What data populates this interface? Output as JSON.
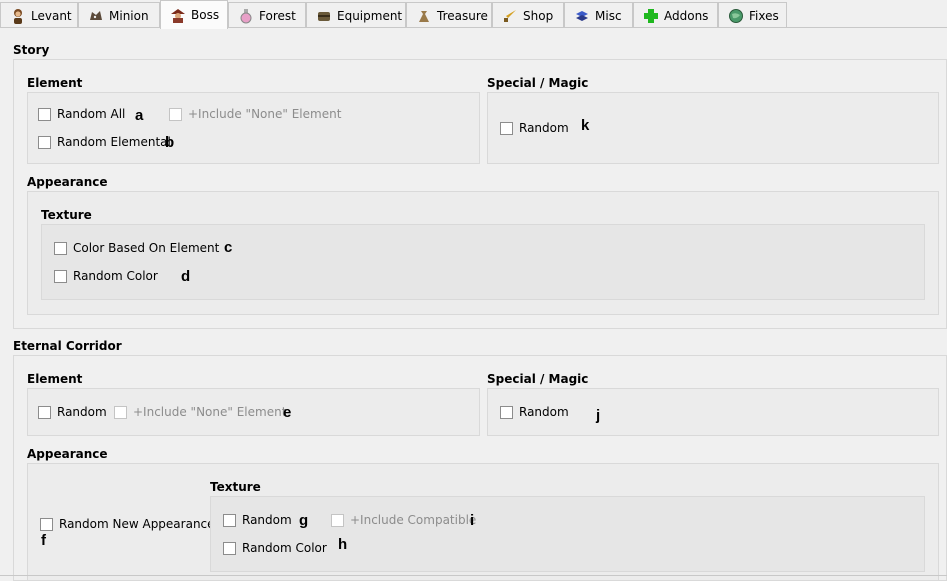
{
  "tabs": [
    {
      "label": "Levant",
      "icon": "character-icon",
      "active": false
    },
    {
      "label": "Minion",
      "icon": "beast-icon",
      "active": false
    },
    {
      "label": "Boss",
      "icon": "boss-icon",
      "active": true
    },
    {
      "label": "Forest",
      "icon": "potion-icon",
      "active": false
    },
    {
      "label": "Equipment",
      "icon": "chest-icon",
      "active": false
    },
    {
      "label": "Treasure",
      "icon": "bag-icon",
      "active": false
    },
    {
      "label": "Shop",
      "icon": "sword-icon",
      "active": false
    },
    {
      "label": "Misc",
      "icon": "misc-icon",
      "active": false
    },
    {
      "label": "Addons",
      "icon": "plus-icon",
      "active": false
    },
    {
      "label": "Fixes",
      "icon": "globe-icon",
      "active": false
    }
  ],
  "story": {
    "title": "Story",
    "element": {
      "title": "Element",
      "random_all": "Random All",
      "include_none": "+Include \"None\" Element",
      "random_elemental": "Random Elemental"
    },
    "special": {
      "title": "Special / Magic",
      "random": "Random"
    },
    "appearance": {
      "title": "Appearance",
      "texture": {
        "title": "Texture",
        "color_based": "Color Based On Element",
        "random_color": "Random Color"
      }
    }
  },
  "corridor": {
    "title": "Eternal Corridor",
    "element": {
      "title": "Element",
      "random": "Random",
      "include_none": "+Include \"None\" Element"
    },
    "special": {
      "title": "Special / Magic",
      "random": "Random"
    },
    "appearance": {
      "title": "Appearance",
      "random_new": "Random New Appearance",
      "texture": {
        "title": "Texture",
        "random": "Random",
        "include_compatible": "+Include Compatible",
        "random_color": "Random Color"
      }
    }
  },
  "annotations": {
    "a": "a",
    "b": "b",
    "c": "c",
    "d": "d",
    "e": "e",
    "f": "f",
    "g": "g",
    "h": "h",
    "i": "i",
    "j": "j",
    "k": "k"
  },
  "colors": {
    "background": "#f0f0f0",
    "panel": "#ececec",
    "border": "#d9d9d9",
    "disabled_text": "#8c8c8c",
    "plus_icon": "#1fb81f"
  }
}
